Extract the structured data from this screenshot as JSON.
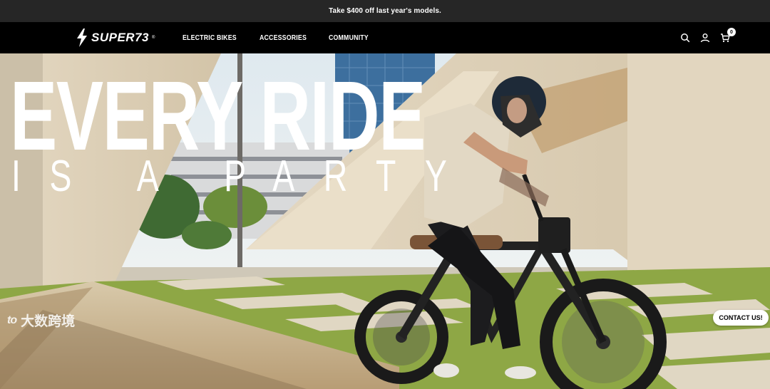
{
  "announcement": {
    "text": "Take $400 off last year's models."
  },
  "brand": {
    "name": "SUPER73",
    "reg": "®"
  },
  "nav": {
    "items": [
      {
        "label": "ELECTRIC BIKES"
      },
      {
        "label": "ACCESSORIES"
      },
      {
        "label": "COMMUNITY"
      }
    ],
    "cart_count": "0"
  },
  "hero": {
    "headline": "EVERY RIDE",
    "subline": "IS A PARTY"
  },
  "watermark": {
    "mark": "to",
    "text": "大数跨境"
  },
  "contact": {
    "label": "CONTACT US!"
  },
  "colors": {
    "announce_bg": "#262626",
    "nav_bg": "#000000",
    "text": "#ffffff"
  },
  "icons": [
    "logo-bolt-icon",
    "search-icon",
    "account-icon",
    "cart-icon"
  ]
}
